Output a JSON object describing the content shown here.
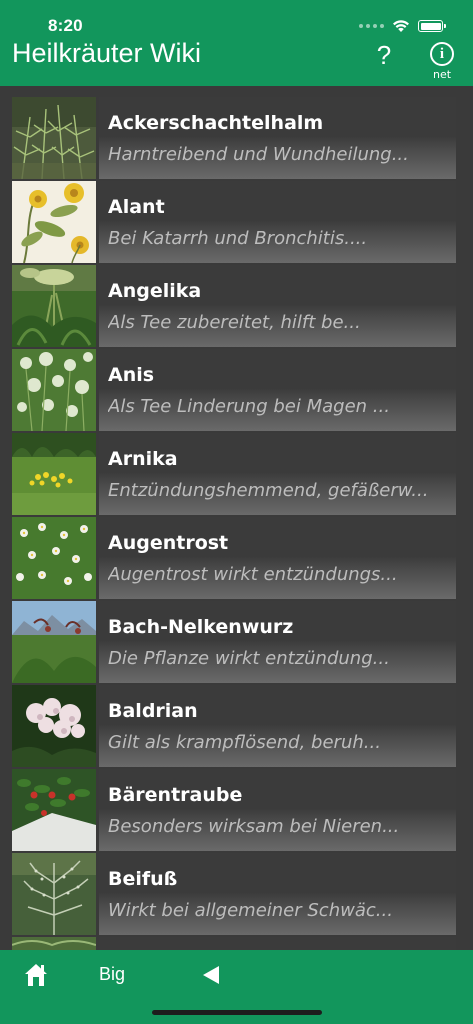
{
  "status_bar": {
    "time": "8:20"
  },
  "header": {
    "title": "Heilkräuter Wiki",
    "help_label": "?",
    "info_symbol": "i",
    "info_label": "net"
  },
  "herbs": [
    {
      "name": "Ackerschachtelhalm",
      "description": "Harntreibend und Wundheilung...",
      "thumbnail": "horsetail-photo"
    },
    {
      "name": "Alant",
      "description": "Bei Katarrh und Bronchitis....",
      "thumbnail": "elecampane-illustration"
    },
    {
      "name": "Angelika",
      "description": "Als Tee zubereitet, hilft be...",
      "thumbnail": "angelica-photo"
    },
    {
      "name": "Anis",
      "description": "Als Tee Linderung bei Magen ...",
      "thumbnail": "anise-photo"
    },
    {
      "name": "Arnika",
      "description": "Entzündungshemmend, gefäßerw...",
      "thumbnail": "arnica-meadow-photo"
    },
    {
      "name": "Augentrost",
      "description": "Augentrost wirkt entzündungs...",
      "thumbnail": "eyebright-photo"
    },
    {
      "name": "Bach-Nelkenwurz",
      "description": "Die Pflanze wirkt entzündung...",
      "thumbnail": "water-avens-photo"
    },
    {
      "name": "Baldrian",
      "description": "Gilt als krampflösend, beruh...",
      "thumbnail": "valerian-photo"
    },
    {
      "name": "Bärentraube",
      "description": "Besonders wirksam bei Nieren...",
      "thumbnail": "bearberry-photo"
    },
    {
      "name": "Beifuß",
      "description": "Wirkt bei allgemeiner Schwäc...",
      "thumbnail": "mugwort-photo"
    },
    {
      "name": "",
      "description": "",
      "thumbnail": "partial-next-photo"
    }
  ],
  "tab_bar": {
    "big_label": "Big"
  },
  "colors": {
    "accent_green": "#12965c",
    "background": "#3a3a3a",
    "name_text": "#ffffff",
    "description_text": "#bdbdbd"
  },
  "icons": {
    "home": "home-icon",
    "back": "back-triangle-icon",
    "help": "question-mark",
    "info": "info-circle-icon",
    "wifi": "wifi-icon",
    "battery": "battery-icon"
  }
}
